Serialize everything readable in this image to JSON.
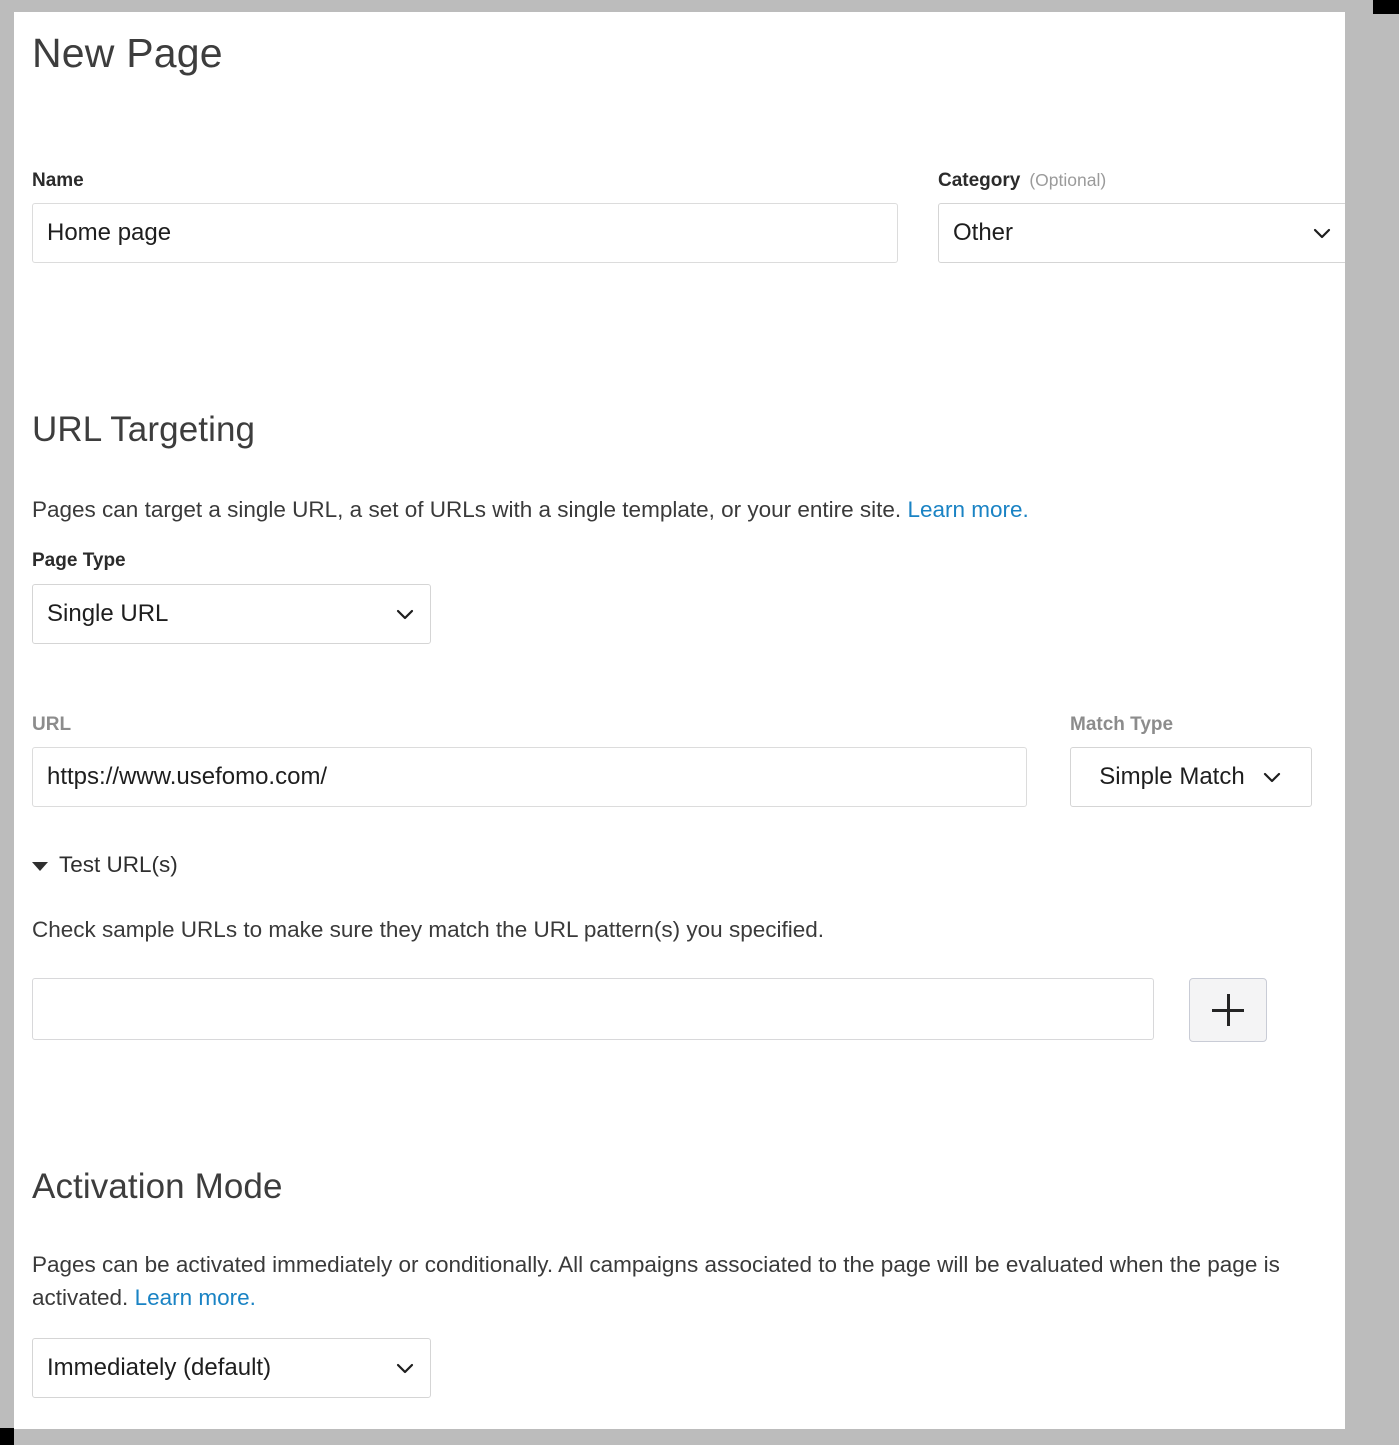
{
  "page": {
    "title": "New Page"
  },
  "name_field": {
    "label": "Name",
    "value": "Home page",
    "placeholder": ""
  },
  "category_field": {
    "label": "Category",
    "optional_tag": "(Optional)",
    "value": "Other",
    "chevron_icon": "chevron-down-icon"
  },
  "url_targeting": {
    "heading": "URL Targeting",
    "description": "Pages can target a single URL, a set of URLs with a single template, or your entire site.",
    "learn_more": "Learn more.",
    "page_type": {
      "label": "Page Type",
      "value": "Single URL",
      "chevron_icon": "chevron-down-icon"
    },
    "url": {
      "label": "URL",
      "value": "https://www.usefomo.com/",
      "placeholder": ""
    },
    "match_type": {
      "label": "Match Type",
      "value": "Simple Match",
      "chevron_icon": "chevron-down-icon"
    },
    "test_urls": {
      "disclosure_label": "Test URL(s)",
      "disclosure_icon": "triangle-down-icon",
      "expanded": true,
      "description": "Check sample URLs to make sure they match the URL pattern(s) you specified.",
      "input_value": "",
      "input_placeholder": "",
      "add_button_icon": "plus-icon"
    }
  },
  "activation_mode": {
    "heading": "Activation Mode",
    "description": "Pages can be activated immediately or conditionally. All campaigns associated to the page will be evaluated when the page is activated.",
    "learn_more": "Learn more.",
    "mode": {
      "value": "Immediately (default)",
      "chevron_icon": "chevron-down-icon"
    }
  },
  "colors": {
    "link": "#1a83c4",
    "background": "#bcbcbc",
    "panel": "#ffffff",
    "border": "#dcdcdc",
    "text": "#3a3a3a",
    "muted_label": "#8c8c8c"
  }
}
